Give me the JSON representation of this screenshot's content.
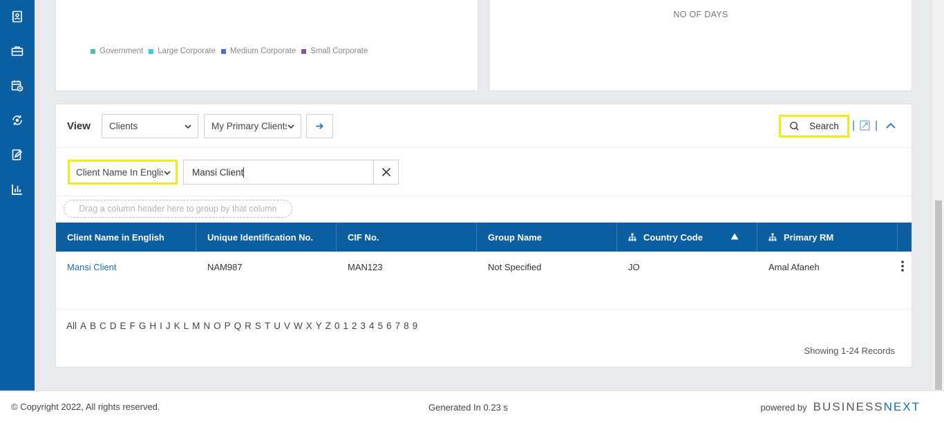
{
  "sidebar": {
    "items": [
      {
        "icon": "contact-book-icon"
      },
      {
        "icon": "briefcase-icon"
      },
      {
        "icon": "calendar-clock-icon"
      },
      {
        "icon": "refresh-cycle-icon"
      },
      {
        "icon": "edit-document-icon"
      },
      {
        "icon": "bar-chart-icon"
      }
    ]
  },
  "chart_left": {
    "legend": [
      {
        "label": "Government",
        "color": "#4fc1a0"
      },
      {
        "label": "Large Corporate",
        "color": "#41c7dd"
      },
      {
        "label": "Medium Corporate",
        "color": "#4a6fd1"
      },
      {
        "label": "Small Corporate",
        "color": "#7d5b9c"
      }
    ]
  },
  "chart_right": {
    "xlabel": "NO OF DAYS"
  },
  "view": {
    "label": "View",
    "entity_select": "Clients",
    "list_select": "My Primary Clients",
    "search_label": "Search"
  },
  "filter": {
    "field_select": "Client Name In English",
    "value": "Mansi Client"
  },
  "group_hint": "Drag a column header here to group by that column",
  "grid": {
    "columns": [
      "Client Name in English",
      "Unique Identification No.",
      "CIF No.",
      "Group Name",
      "Country Code",
      "Primary RM"
    ],
    "rows": [
      [
        "Mansi Client",
        "NAM987",
        "MAN123",
        "Not Specified",
        "JO",
        "Amal Afaneh"
      ]
    ]
  },
  "alphabet": [
    "All",
    "A",
    "B",
    "C",
    "D",
    "E",
    "F",
    "G",
    "H",
    "I",
    "J",
    "K",
    "L",
    "M",
    "N",
    "O",
    "P",
    "Q",
    "R",
    "S",
    "T",
    "U",
    "V",
    "W",
    "X",
    "Y",
    "Z",
    "0",
    "1",
    "2",
    "3",
    "4",
    "5",
    "6",
    "7",
    "8",
    "9"
  ],
  "records_text": "Showing 1-24 Records",
  "footer": {
    "copyright": "© Copyright 2022, All rights reserved.",
    "generated": "Generated In 0.23 s",
    "powered_by": "powered by",
    "brand_a": "BUSINESS",
    "brand_b": "NEXT"
  },
  "colors": {
    "primary": "#0b5ea0",
    "highlight": "#f0ec1a",
    "link": "#1f6fb5"
  }
}
